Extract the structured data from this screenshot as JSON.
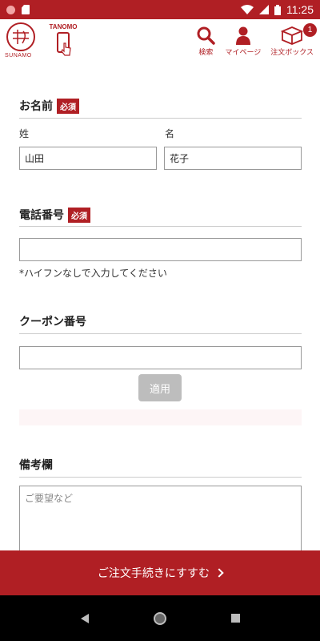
{
  "status_bar": {
    "time": "11:25"
  },
  "header": {
    "logo_text": "SUNAMO",
    "tanomo_label": "TANOMO",
    "actions": [
      {
        "label": "検索",
        "icon": "search-icon"
      },
      {
        "label": "マイページ",
        "icon": "user-icon"
      },
      {
        "label": "注文ボックス",
        "icon": "box-icon"
      }
    ],
    "cart_count": "1"
  },
  "form": {
    "name": {
      "heading": "お名前",
      "required": "必須",
      "last_label": "姓",
      "first_label": "名",
      "last_value": "山田",
      "first_value": "花子"
    },
    "phone": {
      "heading": "電話番号",
      "required": "必須",
      "value": "",
      "helper": "*ハイフンなしで入力してください"
    },
    "coupon": {
      "heading": "クーポン番号",
      "value": "",
      "apply_label": "適用"
    },
    "notes": {
      "heading": "備考欄",
      "placeholder": "ご要望など"
    }
  },
  "cta": {
    "label": "ご注文手続きにすすむ"
  },
  "colors": {
    "brand": "#b01f24",
    "disabled": "#bdbdbd"
  }
}
